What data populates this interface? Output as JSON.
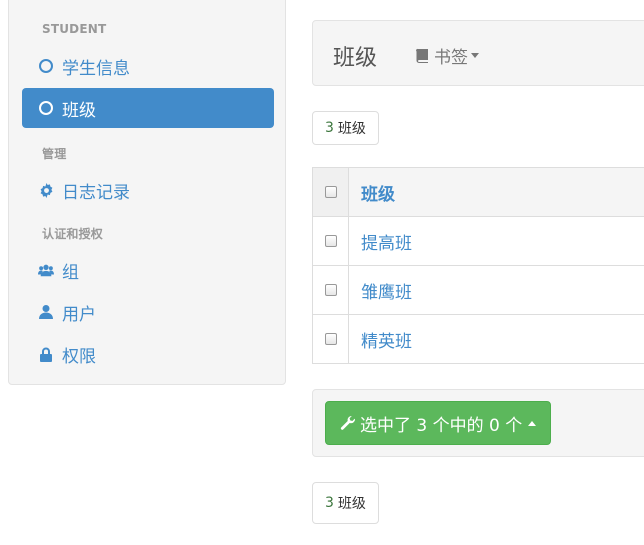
{
  "sidebar": {
    "sections": [
      {
        "header": "STUDENT"
      },
      {
        "header": "管理"
      },
      {
        "header": "认证和授权"
      }
    ],
    "items": [
      {
        "label": "学生信息",
        "icon": "circle-outline-icon",
        "active": false
      },
      {
        "label": "班级",
        "icon": "circle-outline-icon",
        "active": true
      },
      {
        "label": "日志记录",
        "icon": "gear-icon",
        "active": false
      },
      {
        "label": "组",
        "icon": "users-icon",
        "active": false
      },
      {
        "label": "用户",
        "icon": "user-icon",
        "active": false
      },
      {
        "label": "权限",
        "icon": "lock-icon",
        "active": false
      }
    ]
  },
  "topbar": {
    "title": "班级",
    "bookmark_label": "书签"
  },
  "result_count_top": {
    "count": "3",
    "label": "班级"
  },
  "table": {
    "header": "班级",
    "rows": [
      "提高班",
      "雏鹰班",
      "精英班"
    ]
  },
  "actions": {
    "label": "选中了 3 个中的 0 个"
  },
  "result_count_bottom": {
    "count": "3",
    "label": "班级"
  },
  "colors": {
    "primary": "#428bca",
    "success": "#5cb85c",
    "count_green": "#3c763d"
  }
}
